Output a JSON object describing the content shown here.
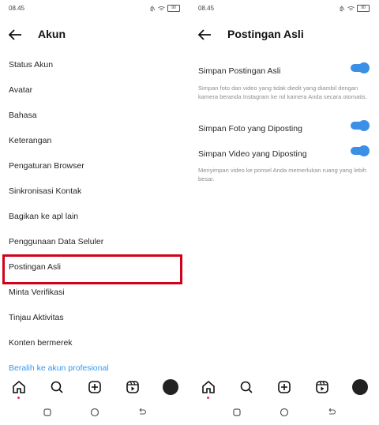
{
  "status": {
    "time_left": "08.45",
    "time_right": "08.45",
    "battery": "90"
  },
  "left": {
    "title": "Akun",
    "items": [
      "Status Akun",
      "Avatar",
      "Bahasa",
      "Keterangan",
      "Pengaturan Browser",
      "Sinkronisasi Kontak",
      "Bagikan ke apl lain",
      "Penggunaan Data Seluler",
      "Postingan Asli",
      "Minta Verifikasi",
      "Tinjau Aktivitas",
      "Konten bermerek"
    ],
    "pro_link": "Beralih ke akun profesional"
  },
  "right": {
    "title": "Postingan Asli",
    "save_original_label": "Simpan Postingan Asli",
    "save_original_desc": "Simpan foto dan video yang tidak diedit yang diambil dengan kamera beranda Instagram ke rol kamera Anda secara otomatis.",
    "save_photos_label": "Simpan Foto yang Diposting",
    "save_videos_label": "Simpan Video yang Diposting",
    "save_videos_desc": "Menyimpan video ke ponsel Anda memerlukan ruang yang lebih besar.",
    "toggles": {
      "save_original": true,
      "save_photos": true,
      "save_videos": true
    }
  },
  "icons": [
    "home-icon",
    "search-icon",
    "new-post-icon",
    "reels-icon",
    "profile-avatar",
    "back-arrow-icon",
    "recent-apps-icon",
    "home-nav-icon",
    "back-nav-icon"
  ],
  "colors": {
    "accent": "#3b8fe6",
    "link": "#3897f0",
    "highlight": "#d0021b"
  }
}
